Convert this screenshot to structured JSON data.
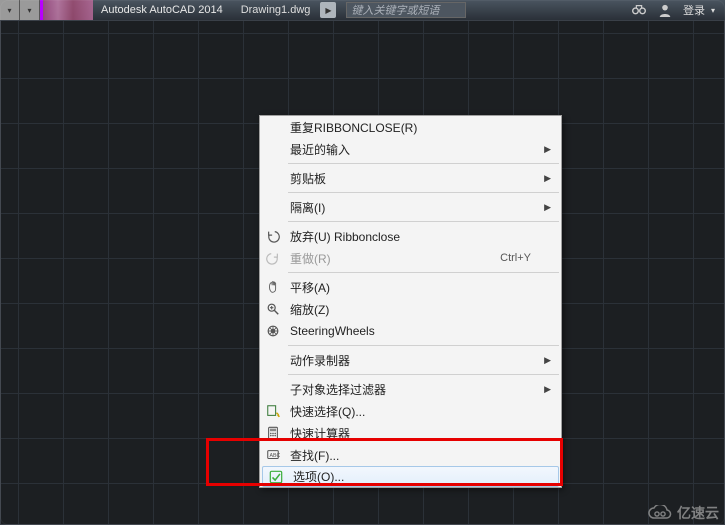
{
  "titlebar": {
    "app_name": "Autodesk AutoCAD 2014",
    "file_name": "Drawing1.dwg",
    "search_placeholder": "键入关键字或短语",
    "login_label": "登录"
  },
  "context_menu": {
    "items": [
      {
        "label": "重复RIBBONCLOSE(R)"
      },
      {
        "label": "最近的输入",
        "submenu": true
      },
      {
        "sep": true
      },
      {
        "label": "剪贴板",
        "submenu": true
      },
      {
        "sep": true
      },
      {
        "label": "隔离(I)",
        "submenu": true
      },
      {
        "sep": true
      },
      {
        "label": "放弃(U) Ribbonclose",
        "icon": "undo"
      },
      {
        "label": "重做(R)",
        "icon": "redo",
        "shortcut": "Ctrl+Y",
        "disabled": true
      },
      {
        "sep": true
      },
      {
        "label": "平移(A)",
        "icon": "pan"
      },
      {
        "label": "缩放(Z)",
        "icon": "zoom"
      },
      {
        "label": "SteeringWheels",
        "icon": "wheel"
      },
      {
        "sep": true
      },
      {
        "label": "动作录制器",
        "submenu": true
      },
      {
        "sep": true
      },
      {
        "label": "子对象选择过滤器",
        "submenu": true
      },
      {
        "label": "快速选择(Q)...",
        "icon": "qselect"
      },
      {
        "label": "快速计算器",
        "icon": "calc"
      },
      {
        "label": "查找(F)...",
        "icon": "find"
      },
      {
        "label": "选项(O)...",
        "icon": "check",
        "highlight": true
      }
    ]
  },
  "watermark": {
    "text": "亿速云"
  }
}
